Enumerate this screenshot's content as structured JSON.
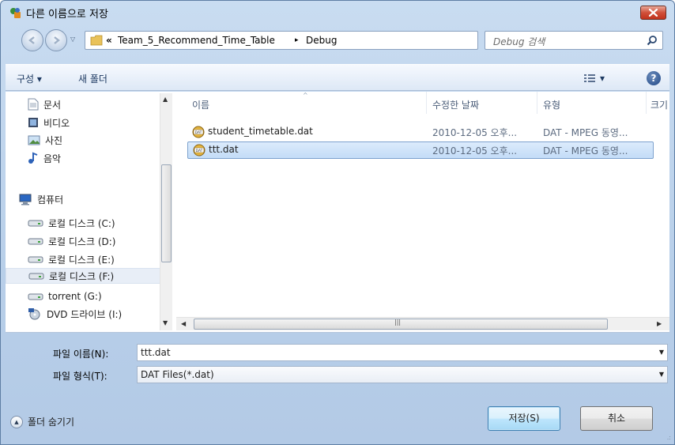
{
  "window": {
    "title": "다른 이름으로 저장"
  },
  "address": {
    "overflow": "«",
    "crumbs": [
      "Team_5_Recommend_Time_Table",
      "Debug"
    ],
    "separator": "▸"
  },
  "search": {
    "placeholder": "Debug 검색"
  },
  "toolbar": {
    "organize": "구성 ▾",
    "new_folder": "새 폴더",
    "view_drop": "▾"
  },
  "nav": {
    "items": [
      {
        "label": "문서",
        "icon": "document-icon"
      },
      {
        "label": "비디오",
        "icon": "video-icon"
      },
      {
        "label": "사진",
        "icon": "picture-icon"
      },
      {
        "label": "음악",
        "icon": "music-icon"
      },
      {
        "label": "컴퓨터",
        "icon": "computer-icon"
      },
      {
        "label": "로컬 디스크 (C:)",
        "icon": "drive-icon"
      },
      {
        "label": "로컬 디스크 (D:)",
        "icon": "drive-icon"
      },
      {
        "label": "로컬 디스크 (E:)",
        "icon": "drive-icon"
      },
      {
        "label": "로컬 디스크 (F:)",
        "icon": "drive-icon",
        "selected": true
      },
      {
        "label": "torrent (G:)",
        "icon": "drive-icon"
      },
      {
        "label": "DVD 드라이브 (I:)",
        "icon": "dvd-icon"
      }
    ]
  },
  "files": {
    "columns": [
      "이름",
      "수정한 날짜",
      "유형",
      "크기"
    ],
    "rows": [
      {
        "name": "student_timetable.dat",
        "modified": "2010-12-05 오후...",
        "type": "DAT - MPEG 동영..."
      },
      {
        "name": "ttt.dat",
        "modified": "2010-12-05 오후...",
        "type": "DAT - MPEG 동영...",
        "selected": true
      }
    ]
  },
  "form": {
    "filename_label": "파일 이름(N):",
    "filename_value": "ttt.dat",
    "filetype_label": "파일 형식(T):",
    "filetype_value": "DAT Files(*.dat)"
  },
  "footer": {
    "hide_folders": "폴더 숨기기",
    "save_label": "저장(S)",
    "cancel_label": "취소"
  },
  "colors": {
    "selection": "#c3dcf7",
    "link": "#1e3a62",
    "frame": "#b8cfe9"
  }
}
